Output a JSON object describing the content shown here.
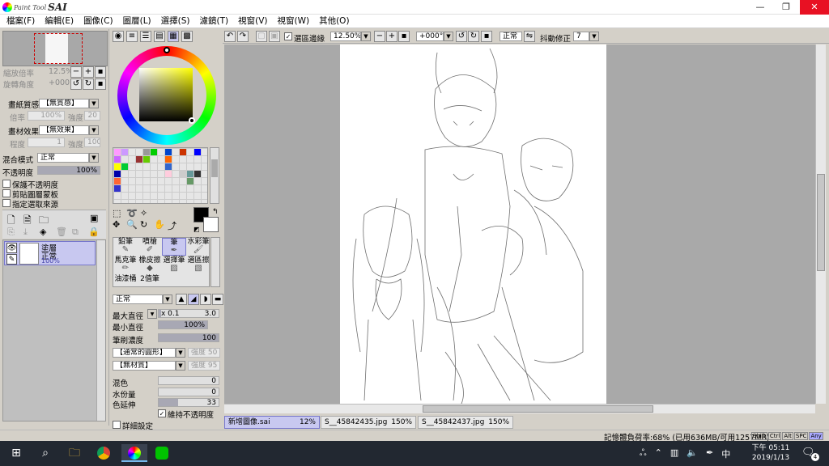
{
  "window": {
    "logo_small": "Paint Tool",
    "logo_big": "SAI",
    "minimize": "—",
    "maximize": "❐",
    "close": "✕"
  },
  "menu": [
    "檔案(F)",
    "編輯(E)",
    "圖像(C)",
    "圖層(L)",
    "選擇(S)",
    "濾鏡(T)",
    "視窗(V)",
    "視窗(W)",
    "其他(O)"
  ],
  "navigator": {
    "zoom_label": "縮放倍率",
    "zoom_value": "12.5%",
    "rotate_label": "旋轉角度",
    "rotate_value": "+000"
  },
  "paper_texture": {
    "label": "畫紙質感",
    "value": "【無質感】",
    "scale_label": "倍率",
    "scale_value": "100%",
    "strength_label": "強度",
    "strength_value": "20"
  },
  "paper_effect": {
    "label": "畫材效果",
    "value": "【無效果】",
    "degree_label": "程度",
    "degree_value": "1",
    "strength_label": "強度",
    "strength_value": "100"
  },
  "blend": {
    "label": "混合模式",
    "value": "正常",
    "opacity_label": "不透明度",
    "opacity_value": "100%"
  },
  "options": {
    "protect_opacity": "保護不透明度",
    "clip_layer": "剪貼圖層蒙板",
    "selection_source": "指定選取來源"
  },
  "layer": {
    "name": "塗層",
    "mode": "正常",
    "opacity": "100%"
  },
  "toolbar": {
    "show_selection": "選區邊緣",
    "zoom": "12.50%",
    "rotate": "+000°",
    "mode": "正常",
    "stabilizer_label": "抖動修正",
    "stabilizer_value": "7"
  },
  "tools_grid": [
    {
      "label": "鉛筆",
      "icon": "pencil-icon"
    },
    {
      "label": "噴槍",
      "icon": "airbrush-icon"
    },
    {
      "label": "筆",
      "icon": "pen-icon"
    },
    {
      "label": "水彩筆",
      "icon": "watercolor-icon"
    },
    {
      "label": "馬克筆",
      "icon": "marker-icon"
    },
    {
      "label": "橡皮擦",
      "icon": "eraser-icon"
    },
    {
      "label": "選擇筆",
      "icon": "select-pen-icon"
    },
    {
      "label": "選區擦",
      "icon": "select-eraser-icon"
    },
    {
      "label": "油漆桶",
      "icon": "bucket-icon"
    },
    {
      "label": "2值筆",
      "icon": "binary-pen-icon"
    }
  ],
  "brush": {
    "mode": "正常",
    "max_size_label": "最大直徑",
    "max_size_mult": "x 0.1",
    "max_size_value": "3.0",
    "min_size_label": "最小直徑",
    "min_size_value": "100%",
    "density_label": "筆刷濃度",
    "density_value": "100",
    "shape": "【通常的圓形】",
    "shape_strength_label": "強度",
    "shape_strength_value": "50",
    "texture": "【無材質】",
    "texture_strength_label": "強度",
    "texture_strength_value": "95",
    "blending_label": "混色",
    "blending_value": "0",
    "dilution_label": "水份量",
    "dilution_value": "0",
    "persistence_label": "色延伸",
    "persistence_value": "33",
    "keep_opacity": "維持不透明度",
    "advanced": "詳細設定"
  },
  "tabs": [
    {
      "name": "新增圖像.sai",
      "zoom": "12%"
    },
    {
      "name": "S__45842435.jpg",
      "zoom": "150%"
    },
    {
      "name": "S__45842437.jpg",
      "zoom": "150%"
    }
  ],
  "status": {
    "memory": "記憶體負荷率:68% (已用636MB/可用1257MB)",
    "keys": [
      "Shift",
      "Ctrl",
      "Alt",
      "SPC",
      "Any"
    ]
  },
  "taskbar": {
    "time": "下午 05:11",
    "date": "2019/1/13",
    "notify_count": "4",
    "lang": "中"
  },
  "colors": {
    "menu_bg": "#ffffff",
    "panel": "#d4d0c8",
    "canvas_bg": "#a9a9a9",
    "active_layer": "#c8c8f0",
    "close_red": "#e81123",
    "taskbar": "#222831"
  }
}
